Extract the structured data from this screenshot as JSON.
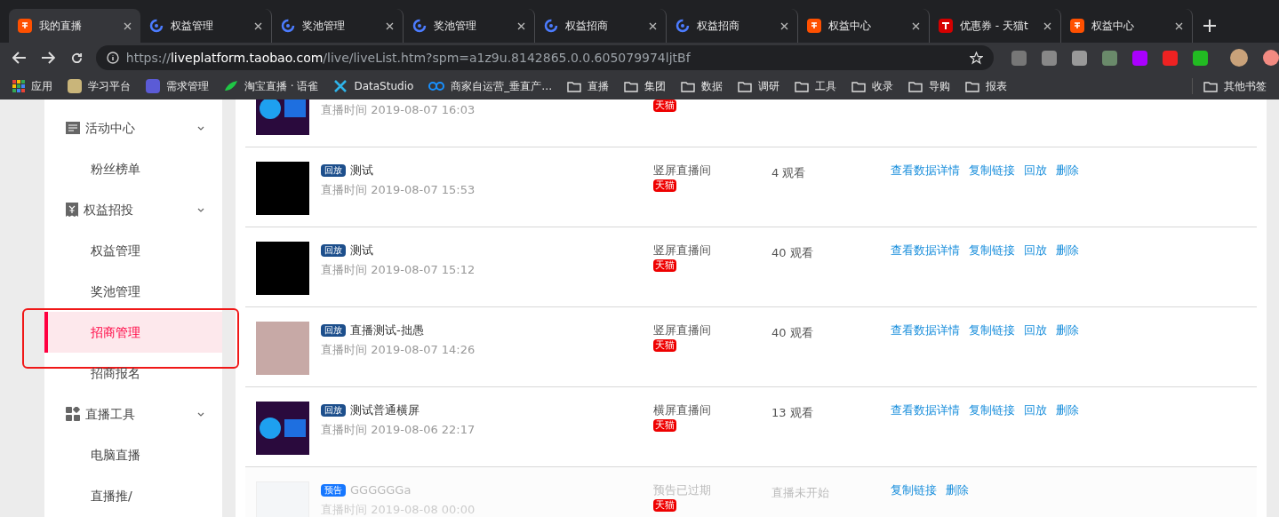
{
  "browser": {
    "tabs": [
      {
        "title": "我的直播",
        "kind": "taobao",
        "selected": true
      },
      {
        "title": "权益管理",
        "kind": "swirl",
        "selected": false
      },
      {
        "title": "奖池管理",
        "kind": "swirl",
        "selected": false
      },
      {
        "title": "奖池管理",
        "kind": "swirl",
        "selected": false
      },
      {
        "title": "权益招商",
        "kind": "swirl",
        "selected": false
      },
      {
        "title": "权益招商",
        "kind": "swirl",
        "selected": false
      },
      {
        "title": "权益中心",
        "kind": "taobao",
        "selected": false
      },
      {
        "title": "优惠券 - 天猫t",
        "kind": "tmall",
        "selected": false
      },
      {
        "title": "权益中心",
        "kind": "taobao",
        "selected": false
      }
    ],
    "address": {
      "scheme": "https://",
      "host": "liveplatform.taobao.com",
      "path": "/live/liveList.htm?spm=a1z9u.8142865.0.0.605079974ljtBf"
    },
    "bookmarks": [
      {
        "label": "应用",
        "kind": "apps"
      },
      {
        "label": "学习平台",
        "kind": "learn"
      },
      {
        "label": "需求管理",
        "kind": "letter"
      },
      {
        "label": "淘宝直播 · 语雀",
        "kind": "bird"
      },
      {
        "label": "DataStudio",
        "kind": "tools"
      },
      {
        "label": "商家自运营_垂直产…",
        "kind": "link"
      },
      {
        "label": "直播",
        "kind": "folder"
      },
      {
        "label": "集团",
        "kind": "folder"
      },
      {
        "label": "数据",
        "kind": "folder"
      },
      {
        "label": "调研",
        "kind": "folder"
      },
      {
        "label": "工具",
        "kind": "folder"
      },
      {
        "label": "收录",
        "kind": "folder"
      },
      {
        "label": "导购",
        "kind": "folder"
      },
      {
        "label": "报表",
        "kind": "folder"
      }
    ],
    "other_bookmarks": "其他书签"
  },
  "sidebar": {
    "items": [
      {
        "label": "活动中心",
        "kind": "notice",
        "expanded": true,
        "children": [
          {
            "label": "粉丝榜单",
            "selected": false
          }
        ]
      },
      {
        "label": "权益招投",
        "kind": "coupon",
        "expanded": true,
        "children": [
          {
            "label": "权益管理",
            "selected": false
          },
          {
            "label": "奖池管理",
            "selected": false
          },
          {
            "label": "招商管理",
            "selected": true
          },
          {
            "label": "招商报名",
            "selected": false
          }
        ]
      },
      {
        "label": "直播工具",
        "kind": "tiles",
        "expanded": true,
        "children": [
          {
            "label": "电脑直播",
            "selected": false
          },
          {
            "label": "直播推/",
            "selected": false
          }
        ]
      }
    ]
  },
  "live_list": {
    "rows": [
      {
        "kind": "game",
        "time": "直播时间 2019-08-07 16:03",
        "platform": "天猫",
        "expired": false,
        "actions": []
      },
      {
        "kind": "digits",
        "badge": {
          "text": "回放",
          "kind": "replay"
        },
        "title": "测试",
        "time": "直播时间 2019-08-07 15:53",
        "room": "竖屏直播间",
        "platform": "天猫",
        "views": "4 观看",
        "expired": false,
        "actions": [
          "查看数据详情",
          "复制链接",
          "回放",
          "删除"
        ]
      },
      {
        "kind": "digits",
        "badge": {
          "text": "回放",
          "kind": "replay"
        },
        "title": "测试",
        "time": "直播时间 2019-08-07 15:12",
        "room": "竖屏直播间",
        "platform": "天猫",
        "views": "40 观看",
        "expired": false,
        "actions": [
          "查看数据详情",
          "复制链接",
          "回放",
          "删除"
        ]
      },
      {
        "kind": "photo",
        "badge": {
          "text": "回放",
          "kind": "replay"
        },
        "title": "直播测试-拙愚",
        "time": "直播时间 2019-08-07 14:26",
        "room": "竖屏直播间",
        "platform": "天猫",
        "views": "40 观看",
        "expired": false,
        "actions": [
          "查看数据详情",
          "复制链接",
          "回放",
          "删除"
        ]
      },
      {
        "kind": "game",
        "badge": {
          "text": "回放",
          "kind": "replay"
        },
        "title": "测试普通横屏",
        "time": "直播时间 2019-08-06 22:17",
        "room": "横屏直播间",
        "platform": "天猫",
        "views": "13 观看",
        "expired": false,
        "actions": [
          "查看数据详情",
          "复制链接",
          "回放",
          "删除"
        ]
      },
      {
        "kind": "document",
        "badge": {
          "text": "预告",
          "kind": "preview"
        },
        "title": "GGGGGGa",
        "time": "直播时间 2019-08-08 00:00",
        "room": "预告已过期",
        "platform": "天猫",
        "views": "直播未开始",
        "expired": true,
        "actions": [
          "复制链接",
          "删除"
        ]
      }
    ]
  }
}
